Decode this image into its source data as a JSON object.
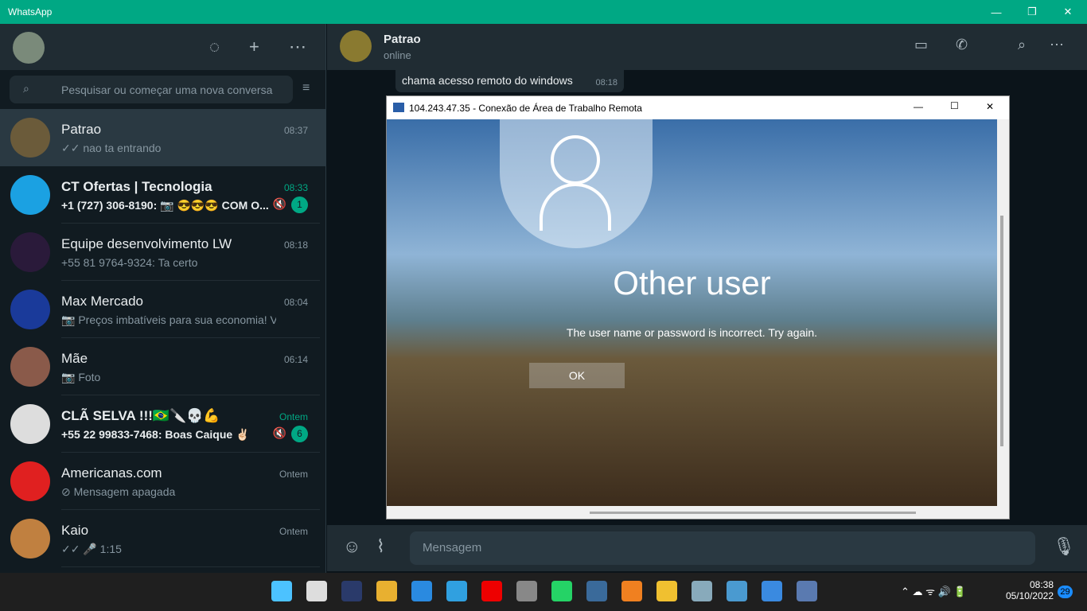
{
  "window": {
    "title": "WhatsApp",
    "minimize": "—",
    "maximize": "❐",
    "close": "✕"
  },
  "sidebar": {
    "search_placeholder": "Pesquisar ou começar uma nova conversa",
    "chats": [
      {
        "name": "Patrao",
        "time": "08:37",
        "message": "✓✓ nao ta entrando"
      },
      {
        "name": "CT Ofertas | Tecnologia",
        "time": "08:33",
        "message": "+1 (727) 306-8190: 📷 😎😎😎 COM O...",
        "unread": "1"
      },
      {
        "name": "Equipe desenvolvimento LW",
        "time": "08:18",
        "message": "+55 81 9764-9324: Ta certo"
      },
      {
        "name": "Max Mercado",
        "time": "08:04",
        "message": "📷 Preços imbatíveis para sua economia! Válido..."
      },
      {
        "name": "Mãe",
        "time": "06:14",
        "message": "📷 Foto"
      },
      {
        "name": "CLÃ SELVA !!!🇧🇷🔪💀💪",
        "time": "Ontem",
        "message": "+55 22 99833-7468: Boas Caique ✌🏻",
        "unread": "6"
      },
      {
        "name": "Americanas.com",
        "time": "Ontem",
        "message": "⊘ Mensagem apagada"
      },
      {
        "name": "Kaio",
        "time": "Ontem",
        "message": "✓✓ 🎤 1:15"
      }
    ]
  },
  "conversation": {
    "contact": "Patrao",
    "status": "online",
    "message": {
      "text": "chama acesso remoto do windows",
      "time": "08:18"
    },
    "input_placeholder": "Mensagem"
  },
  "rdp": {
    "title": "104.243.47.35 - Conexão de Área de Trabalho Remota",
    "user": "Other user",
    "error": "The user name or password is incorrect. Try again.",
    "ok": "OK"
  },
  "taskbar": {
    "time": "08:38",
    "date": "05/10/2022",
    "notifications": "29"
  }
}
